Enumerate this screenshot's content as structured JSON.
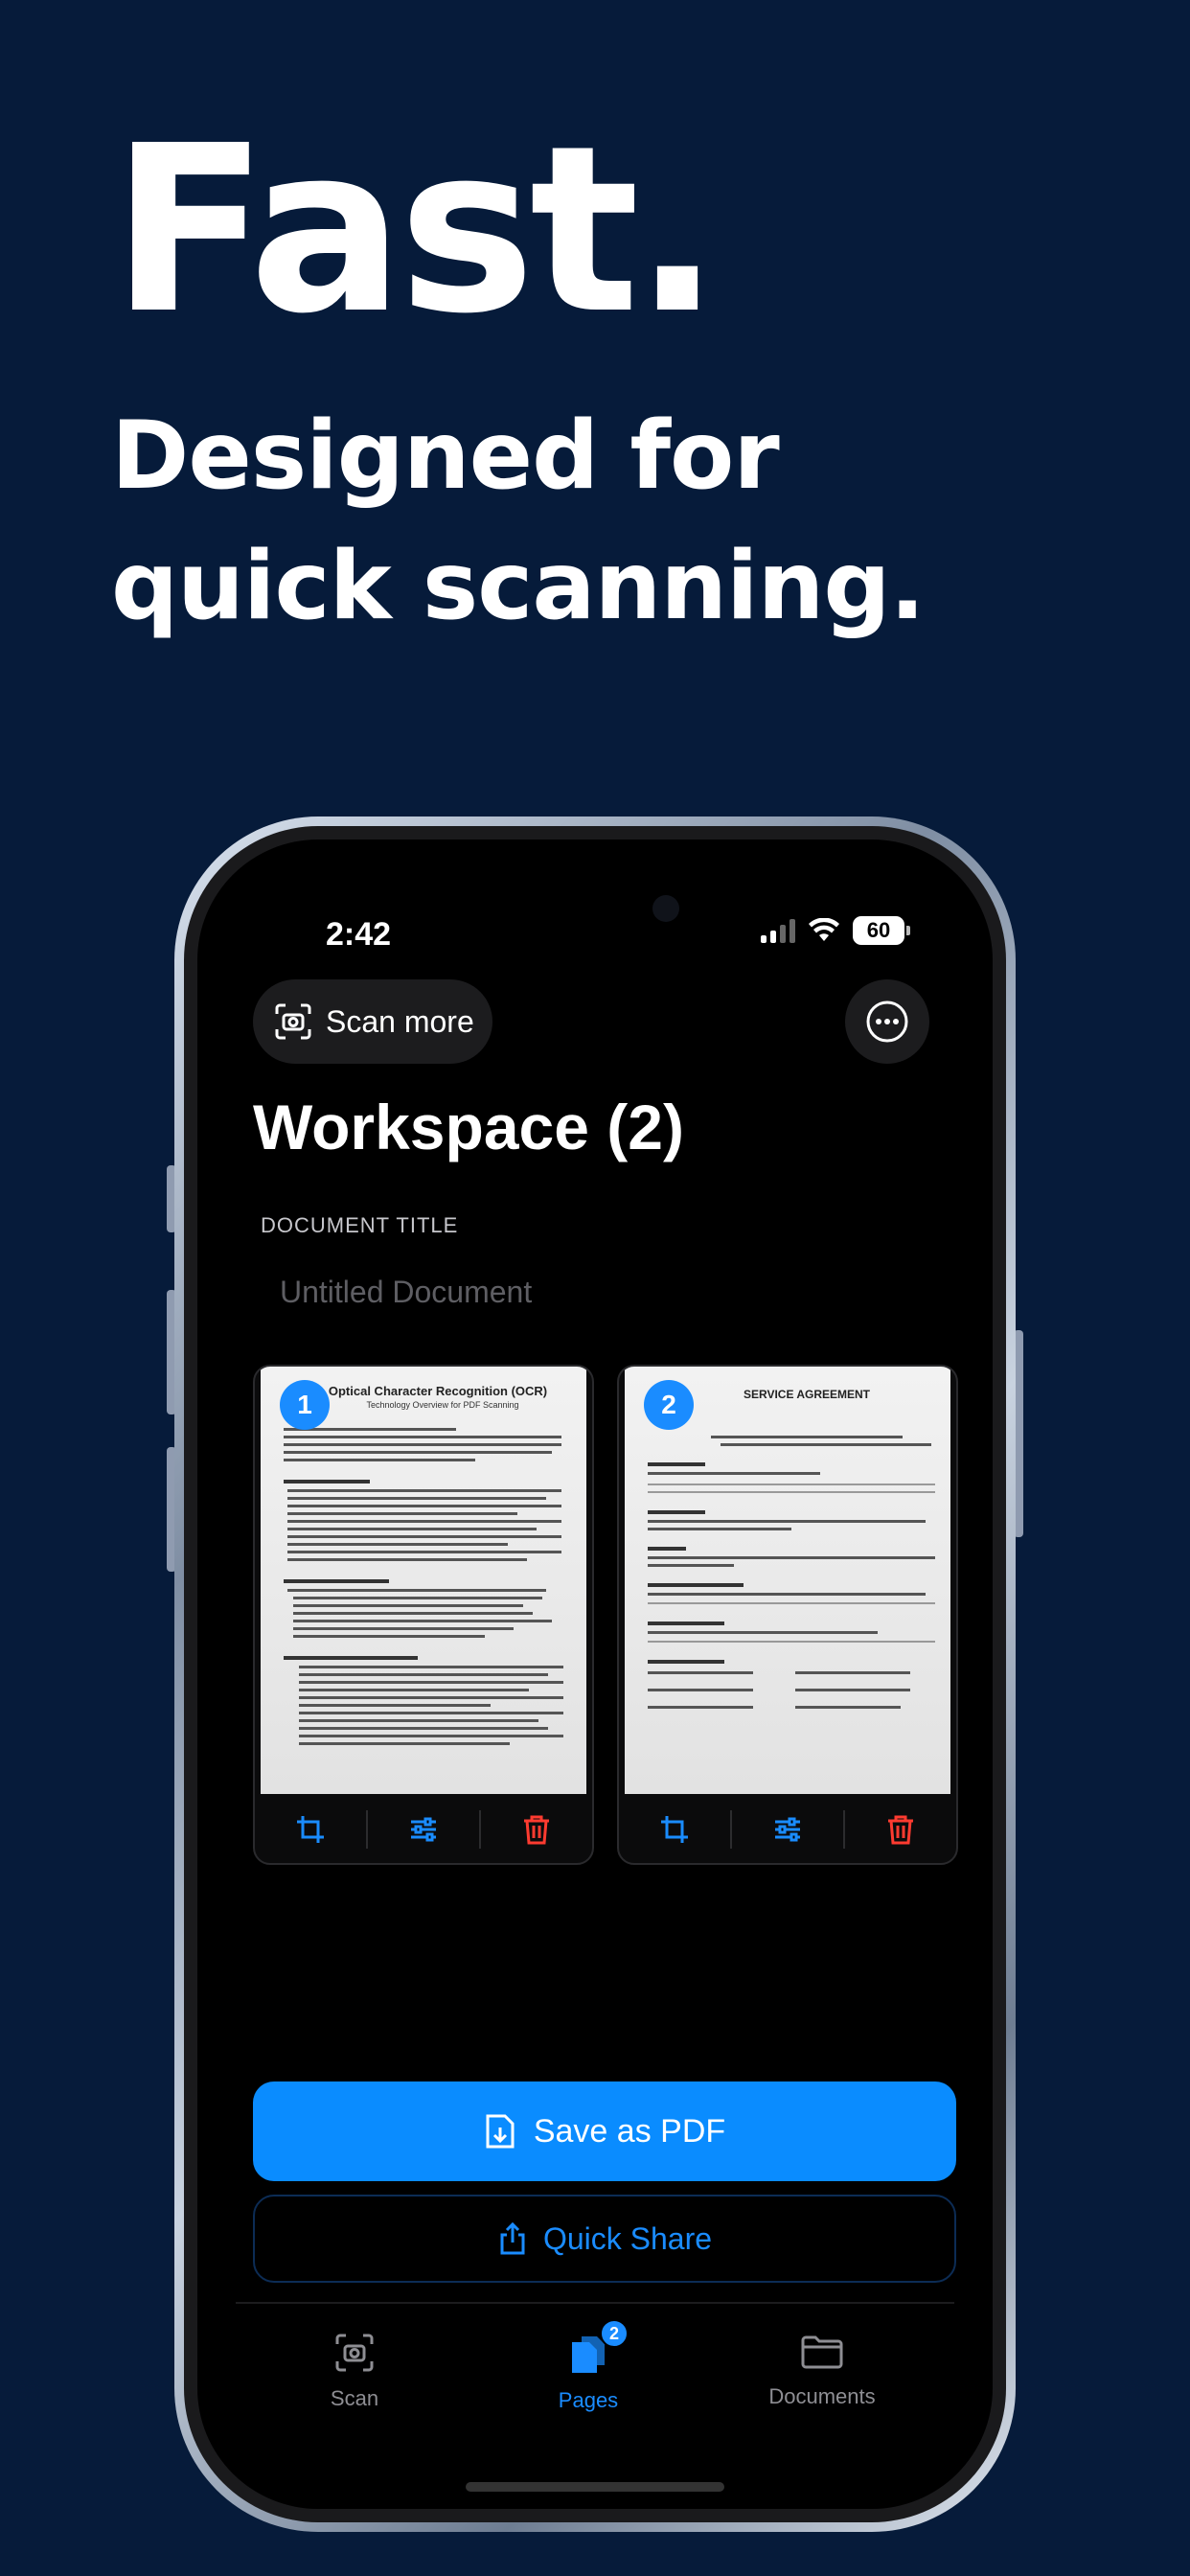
{
  "promo": {
    "headline": "Fast.",
    "subline_1": "Designed for",
    "subline_2": "quick scanning."
  },
  "status_bar": {
    "time": "2:42",
    "battery": "60"
  },
  "toolbar": {
    "scan_more_label": "Scan more",
    "more_icon": "ellipsis-circle-icon"
  },
  "workspace": {
    "title": "Workspace (2)",
    "document_title_label": "DOCUMENT TITLE",
    "document_title_placeholder": "Untitled Document",
    "document_title_value": ""
  },
  "pages": [
    {
      "number": "1",
      "doc_title": "Optical Character Recognition (OCR)",
      "doc_subtitle": "Technology Overview for PDF Scanning",
      "tools": [
        "crop-icon",
        "sliders-icon",
        "trash-icon"
      ]
    },
    {
      "number": "2",
      "doc_title": "SERVICE AGREEMENT",
      "doc_subtitle": "",
      "tools": [
        "crop-icon",
        "sliders-icon",
        "trash-icon"
      ]
    }
  ],
  "actions": {
    "save_label": "Save as PDF",
    "share_label": "Quick Share"
  },
  "tabbar": {
    "tabs": [
      {
        "label": "Scan",
        "icon": "camera-icon",
        "active": false
      },
      {
        "label": "Pages",
        "icon": "pages-icon",
        "active": true,
        "badge": "2"
      },
      {
        "label": "Documents",
        "icon": "folder-icon",
        "active": false
      }
    ]
  },
  "colors": {
    "background": "#061b3a",
    "accent": "#0a8cff",
    "danger": "#ff3b30"
  }
}
